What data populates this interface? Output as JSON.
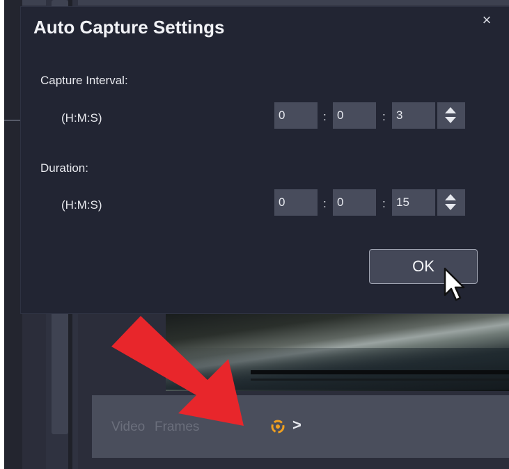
{
  "dialog": {
    "title": "Auto Capture Settings",
    "close_label": "×",
    "capture_interval": {
      "label": "Capture Interval:",
      "unit_label": "(H:M:S)",
      "hours": "0",
      "minutes": "0",
      "seconds": "3"
    },
    "duration": {
      "label": "Duration:",
      "unit_label": "(H:M:S)",
      "hours": "0",
      "minutes": "0",
      "seconds": "15"
    },
    "separator": ":",
    "ok_label": "OK"
  },
  "bottom_bar": {
    "video_label": "Video",
    "frames_label": "Frames",
    "chevron": ">",
    "capture_icon": "auto-capture-icon"
  },
  "colors": {
    "dialog_bg": "#222533",
    "field_bg": "#484c5c",
    "annotation_arrow": "#e8262b",
    "capture_icon": "#f0a020"
  }
}
